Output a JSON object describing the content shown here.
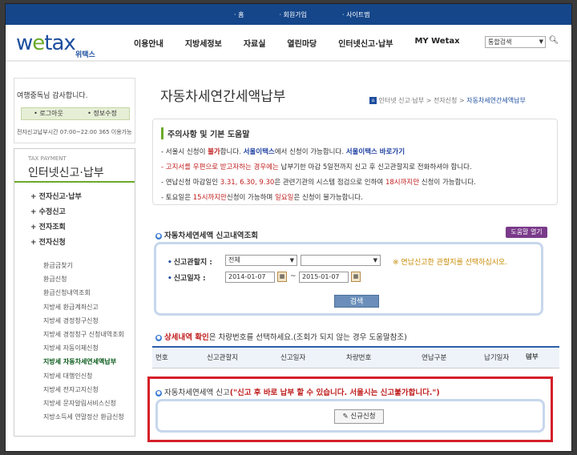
{
  "top_links": [
    "· 홈",
    "· 회원가입",
    "· 사이트맵"
  ],
  "logo": {
    "text": "wetax",
    "sub": "위택스"
  },
  "gnb": [
    "이용안내",
    "지방세정보",
    "자료실",
    "열린마당",
    "인터넷신고·납부",
    "MY Wetax"
  ],
  "search": {
    "scope": "통합검색"
  },
  "welcome": {
    "greeting": "여행중독님 감사합니다.",
    "logout": "• 로그아웃",
    "profile": "• 정보수정",
    "hours": "전자신고납부시간 07:00~22:00 365 이용가능"
  },
  "sidebar": {
    "en": "TAX PAYMENT",
    "title": "인터넷신고·납부",
    "menu": [
      "+ 전자신고·납부",
      "+ 수정신고",
      "+ 전자조회",
      "+ 전자신청"
    ],
    "sub": [
      "환급금찾기",
      "환급신청",
      "환급신청내역조회",
      "지방세 환급계좌신고",
      "지방세 경정청구신청",
      "지방세 경정청구 신청내역조회",
      "지방세 자동이체신청",
      "지방세 자동차세연세액납부",
      "지방세 대행인신청",
      "지방세 전자고지신청",
      "지방세 문자알림서비스신청",
      "지방소득세 연말정산 환급신청"
    ]
  },
  "page": {
    "title": "자동차세연간세액납부",
    "breadcrumb": [
      "인터넷 신고·납부",
      "전자신청",
      "자동차세연간세액납부"
    ]
  },
  "notice": {
    "title": "주의사항 및 기본 도움말",
    "l1a": "- 서울시 신청이 ",
    "l1b": "불가",
    "l1c": "합니다. ",
    "l1d": "서울이택스",
    "l1e": "에서 신청이 가능합니다. ",
    "l1f": "서울이택스 바로가기",
    "l2a": "- 고지서를 우편으로 받고자하는 경우에는",
    "l2b": " 납부기한 마감 5일전까지 신고 후 신고관할지로 전화하셔야 합니다.",
    "l3a": "- 연납신청 마감일인 ",
    "l3b": "3.31, 6.30, 9.30",
    "l3c": "은 관련기관의 시스템 점검으로 인하여 ",
    "l3d": "18시까지만",
    "l3e": " 신청이 가능합니다.",
    "l4a": "- 토요일은 ",
    "l4b": "15시까지만",
    "l4c": "신청이 가능하며 ",
    "l4d": "일요일",
    "l4e": "은 신청이 불가능합니다."
  },
  "inquiry": {
    "title": "자동차세연세액 신고내역조회",
    "help": "도움말 열기",
    "office_label": "신고관할지 :",
    "office_value": "전체",
    "office_sub": "",
    "hint": "※ 연납신고한 관할지를 선택하십시오.",
    "date_label": "신고일자 :",
    "date_from": "2014-01-07",
    "date_to": "2015-01-07",
    "tilde": "~",
    "search_btn": "검색"
  },
  "detail": {
    "t1": "상세내역 확인",
    "t2": "은 차량번호를 선택하세요.(조회가 되지 않는 경우 도움말참조)",
    "columns": [
      "번호",
      "신고관할지",
      "신고일자",
      "차량번호",
      "연납구분",
      "납기일자",
      "납부",
      "여부"
    ]
  },
  "new_report": {
    "t1": "자동차세연세액 신고",
    "t2": "(\"신고 후 바로 납부 할 수 있습니다. 서울시는 신고불가합니다.\")",
    "btn": "신규신청"
  }
}
